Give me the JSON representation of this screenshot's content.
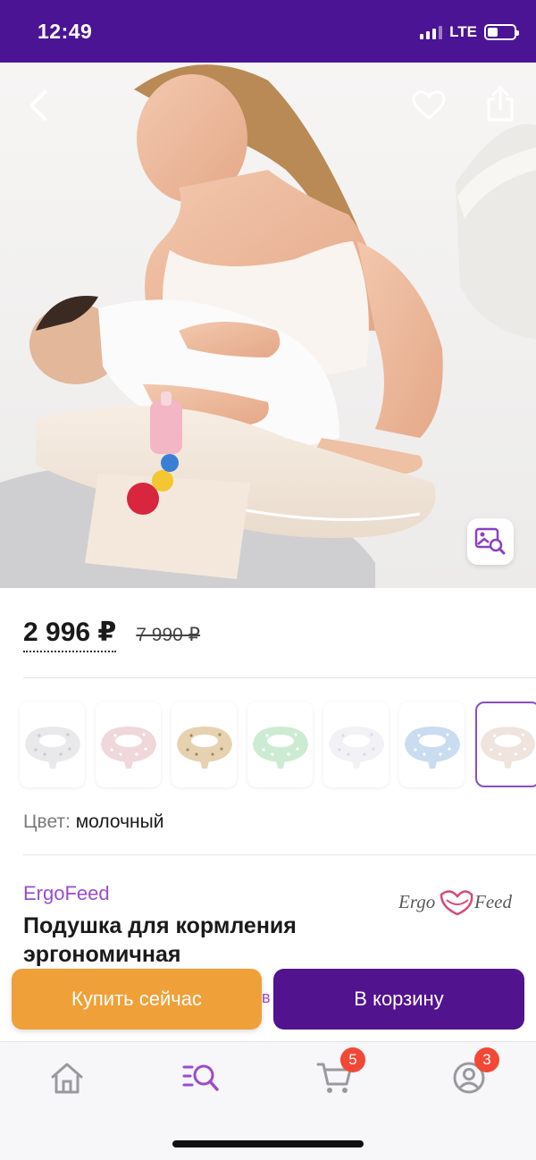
{
  "status": {
    "time": "12:49",
    "network": "LTE"
  },
  "product": {
    "price_current": "2 996 ₽",
    "price_old": "7 990 ₽",
    "color_label": "Цвет:",
    "color_value": "молочный",
    "brand": "ErgoFeed",
    "brand_logo_text_left": "Ergo",
    "brand_logo_text_right": "Feed",
    "title": "Подушка для кормления эргономичная"
  },
  "thumbnails": [
    {
      "color": "#e9e9ec",
      "dots": "#c9c9cf"
    },
    {
      "color": "#efd7da",
      "dots": "#ffffff"
    },
    {
      "color": "#e6d2b1",
      "dots": "#a88a5c"
    },
    {
      "color": "#cdebd3",
      "dots": "#ffffff"
    },
    {
      "color": "#f2f1f6",
      "dots": "#dcdcea"
    },
    {
      "color": "#c9dcf0",
      "dots": "#ffffff"
    },
    {
      "color": "#efe4de",
      "dots": "#ffffff"
    }
  ],
  "actions": {
    "buy_now": "Купить сейчас",
    "add_to_cart": "В корзину",
    "peek_letter": "в"
  },
  "tabbar": {
    "cart_badge": "5",
    "profile_badge": "3"
  },
  "colors": {
    "brand_purple": "#4b1494",
    "cart_button": "#52138f",
    "buy_button": "#f0a038",
    "accent": "#9a4ccc",
    "badge": "#f24835"
  }
}
